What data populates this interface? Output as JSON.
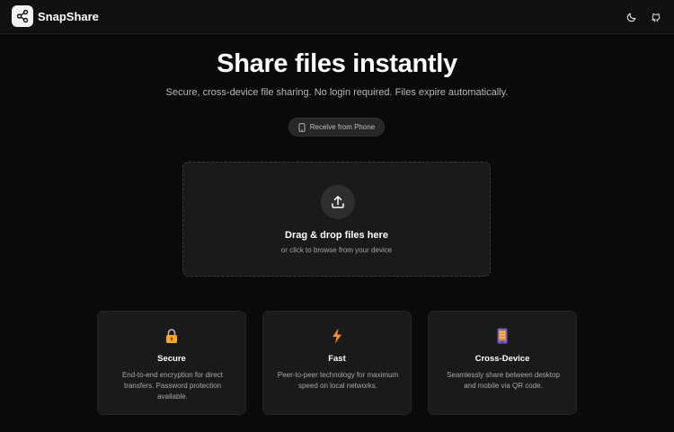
{
  "header": {
    "brand": "SnapShare",
    "icons": [
      "share-icon",
      "moon-icon",
      "github-icon"
    ]
  },
  "hero": {
    "title": "Share files instantly",
    "subtitle": "Secure, cross-device file sharing. No login required. Files expire automatically."
  },
  "receive_button": {
    "label": "Receive from Phone",
    "icon": "phone-icon"
  },
  "dropzone": {
    "icon": "upload-icon",
    "title": "Drag & drop files here",
    "subtitle": "or click to browse from your device"
  },
  "features": [
    {
      "icon": "lock-icon",
      "title": "Secure",
      "description": "End-to-end encryption for direct transfers. Password protection available."
    },
    {
      "icon": "lightning-icon",
      "title": "Fast",
      "description": "Peer-to-peer technology for maximum speed on local networks."
    },
    {
      "icon": "mobile-device-icon",
      "title": "Cross-Device",
      "description": "Seamlessly share between desktop and mobile via QR code."
    }
  ],
  "colors": {
    "background": "#0a0a0a",
    "header": "#111111",
    "card": "#1a1a1a",
    "lock_accent": "#f5a623",
    "lightning_accent": "#f28c28",
    "device_accent": "#6b5bd6"
  }
}
